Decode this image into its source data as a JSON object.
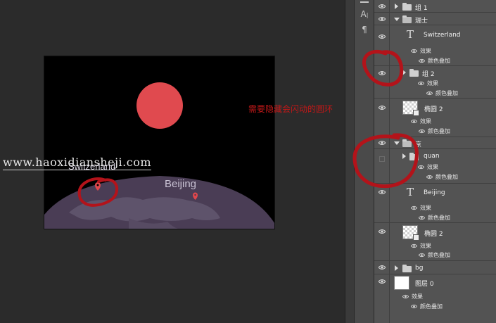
{
  "canvas": {
    "watermark": "www.haoxidiansheji.com",
    "annotation": "需要隐藏会闪动的圆环",
    "labels": {
      "switzerland": "Switzerland",
      "beijing": "Beijing"
    },
    "colors": {
      "sun": "#e04a4f",
      "earth": "#4a3d55",
      "land": "#5e536b",
      "pin": "#e0474c",
      "background": "#000000"
    }
  },
  "tools": [
    "char-panel-icon",
    "type-icon",
    "paragraph-icon"
  ],
  "layers": {
    "group1": "组 1",
    "swiss_group": "瑞士",
    "switzerland_text": "Switzerland",
    "effects": "效果",
    "color_overlay": "颜色叠加",
    "group2": "组 2",
    "ellipse2": "椭圆 2",
    "jing_group": "京",
    "quan": "quan",
    "beijing_text": "Beijing",
    "ellipse2b": "椭圆 2",
    "bg": "bg",
    "layer0": "图层 0"
  }
}
